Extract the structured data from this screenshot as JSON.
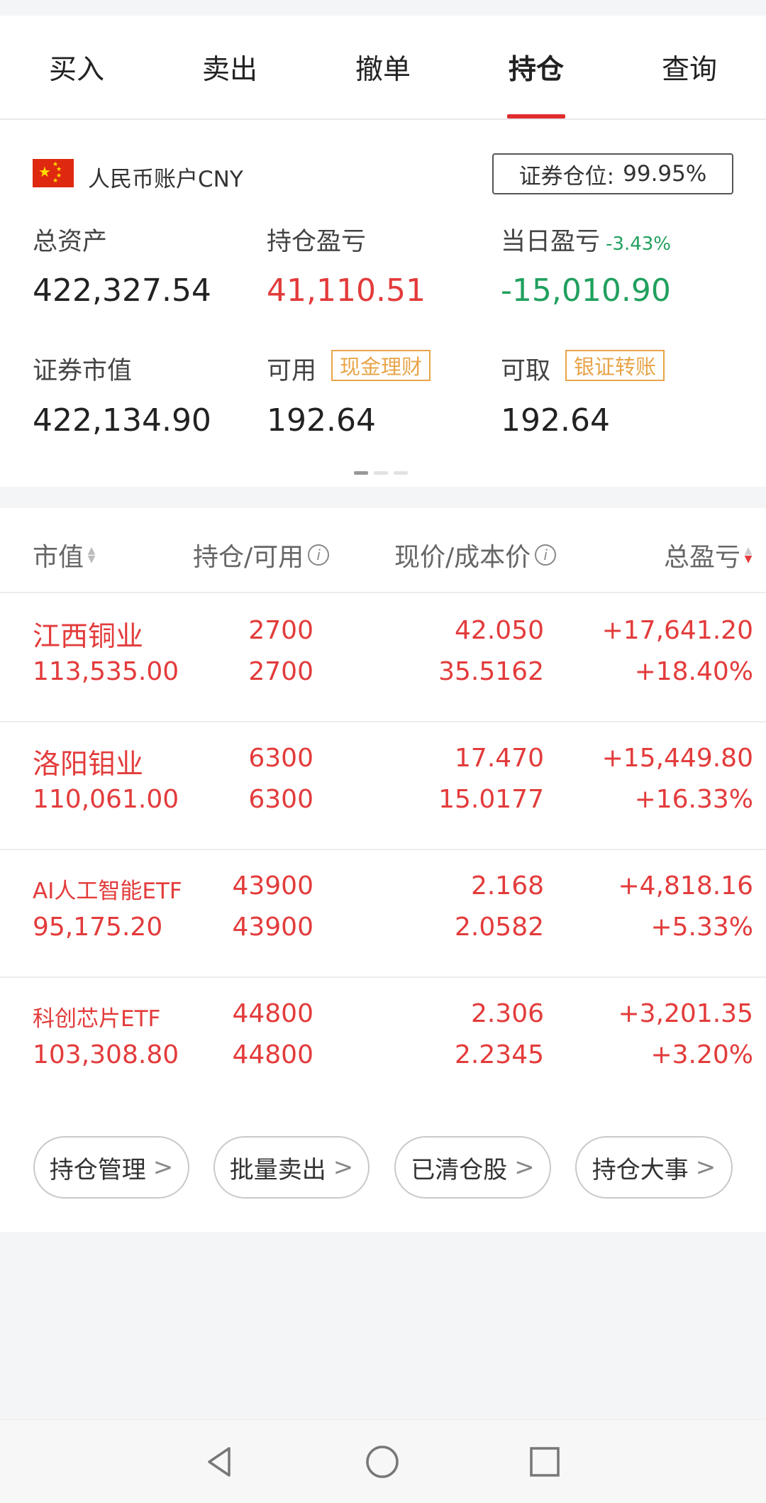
{
  "tabs": [
    {
      "label": "买入",
      "active": false
    },
    {
      "label": "卖出",
      "active": false
    },
    {
      "label": "撤单",
      "active": false
    },
    {
      "label": "持仓",
      "active": true
    },
    {
      "label": "查询",
      "active": false
    }
  ],
  "account": {
    "name": "人民币账户CNY",
    "flag": "china-flag",
    "position_label": "证券仓位:",
    "position_value": "99.95%",
    "total_assets_label": "总资产",
    "total_assets": "422,327.54",
    "holding_pl_label": "持仓盈亏",
    "holding_pl": "41,110.51",
    "daily_pl_label": "当日盈亏",
    "daily_pl_pct": "-3.43%",
    "daily_pl": "-15,010.90",
    "market_value_label": "证券市值",
    "market_value": "422,134.90",
    "available_label": "可用",
    "available_tag": "现金理财",
    "available": "192.64",
    "withdrawable_label": "可取",
    "withdrawable_tag": "银证转账",
    "withdrawable": "192.64"
  },
  "table": {
    "headers": [
      "市值",
      "持仓/可用",
      "现价/成本价",
      "总盈亏"
    ],
    "rows": [
      {
        "name": "江西铜业",
        "market_value": "113,535.00",
        "holding": "2700",
        "available": "2700",
        "price": "42.050",
        "cost": "35.5162",
        "pl": "+17,641.20",
        "pl_pct": "+18.40%"
      },
      {
        "name": "洛阳钼业",
        "market_value": "110,061.00",
        "holding": "6300",
        "available": "6300",
        "price": "17.470",
        "cost": "15.0177",
        "pl": "+15,449.80",
        "pl_pct": "+16.33%"
      },
      {
        "name": "AI人工智能ETF",
        "market_value": "95,175.20",
        "holding": "43900",
        "available": "43900",
        "price": "2.168",
        "cost": "2.0582",
        "pl": "+4,818.16",
        "pl_pct": "+5.33%"
      },
      {
        "name": "科创芯片ETF",
        "market_value": "103,308.80",
        "holding": "44800",
        "available": "44800",
        "price": "2.306",
        "cost": "2.2345",
        "pl": "+3,201.35",
        "pl_pct": "+3.20%"
      }
    ]
  },
  "actions": [
    "持仓管理",
    "批量卖出",
    "已清仓股",
    "持仓大事"
  ],
  "colors": {
    "accent": "#e02d2d",
    "up": "#e33b3b",
    "down": "#21a05e",
    "tag": "#e8a54a"
  }
}
